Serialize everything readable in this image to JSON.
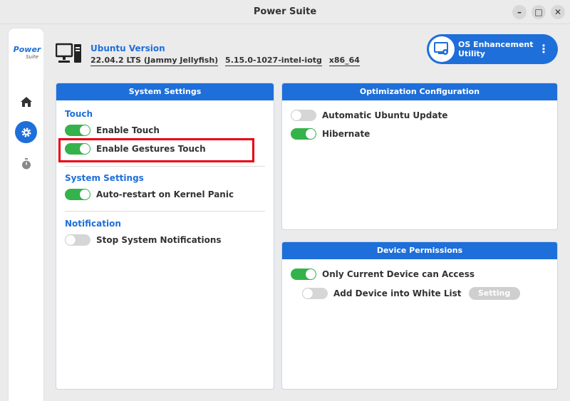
{
  "window": {
    "title": "Power Suite",
    "controls": [
      "–",
      "□",
      "✕"
    ]
  },
  "sidebar": {
    "logo_main": "Power",
    "logo_sub": "Suite",
    "nav": [
      "home-icon",
      "gear-icon",
      "timer-icon"
    ],
    "accent": "#1e6fd9"
  },
  "header": {
    "version_label": "Ubuntu Version",
    "os_version": "22.04.2 LTS (Jammy Jellyfish)",
    "kernel": "5.15.0-1027-intel-iotg",
    "arch": "x86_64",
    "os_enhancement": {
      "line1": "OS Enhancement",
      "line2": "Utility",
      "more": "⋮"
    }
  },
  "system_settings": {
    "title": "System Settings",
    "touch_title": "Touch",
    "enable_touch": {
      "label": "Enable Touch",
      "on": true
    },
    "enable_gestures": {
      "label": "Enable Gestures Touch",
      "on": true
    },
    "system_title": "System Settings",
    "auto_restart": {
      "label": "Auto-restart on Kernel Panic",
      "on": true
    },
    "notification_title": "Notification",
    "stop_notifications": {
      "label": "Stop System Notifications",
      "on": false
    }
  },
  "optimization": {
    "title": "Optimization Configuration",
    "auto_update": {
      "label": "Automatic Ubuntu Update",
      "on": false
    },
    "hibernate": {
      "label": "Hibernate",
      "on": true
    }
  },
  "device_permissions": {
    "title": "Device Permissions",
    "only_current": {
      "label": "Only Current Device can Access",
      "on": true
    },
    "white_list": {
      "label": "Add Device into White List",
      "on": false
    },
    "setting_button": "Setting"
  }
}
